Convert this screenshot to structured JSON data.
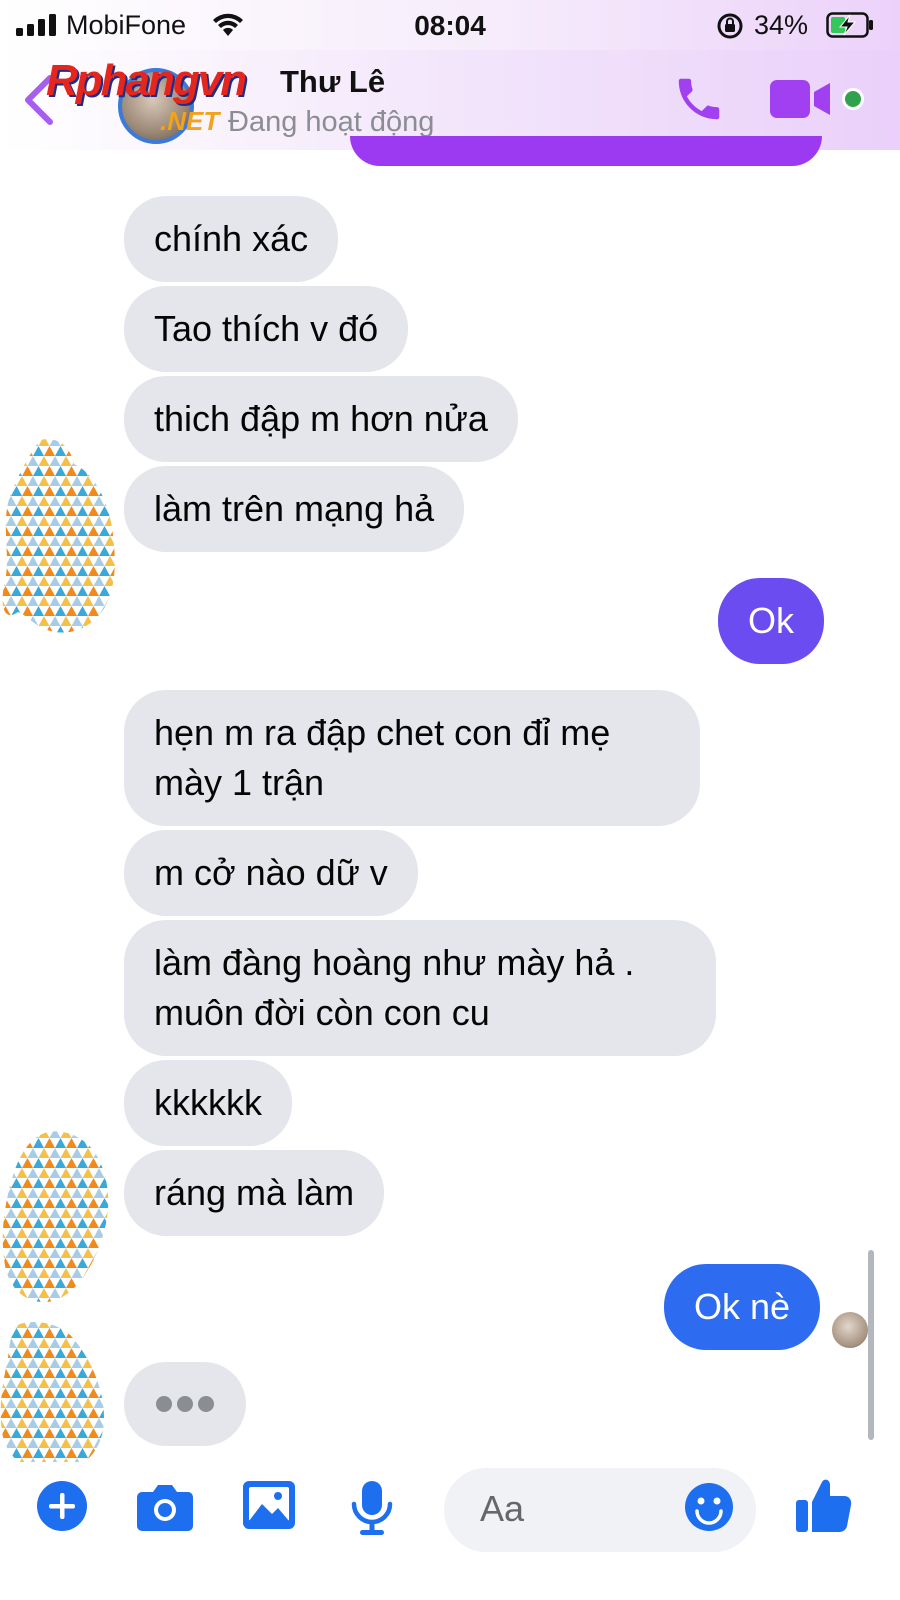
{
  "status_bar": {
    "carrier": "MobiFone",
    "time": "08:04",
    "battery_percent": "34%"
  },
  "header": {
    "watermark": "Rphangvn",
    "watermark_suffix": ".NET",
    "contact_name": "Thư Lê",
    "contact_status": "Đang hoạt động",
    "accent_color": "#9b3af0"
  },
  "messages": [
    {
      "side": "in",
      "text": "chính xác"
    },
    {
      "side": "in",
      "text": "Tao thích v đó"
    },
    {
      "side": "in",
      "text": "thich đập m hơn nửa"
    },
    {
      "side": "in",
      "text": "làm trên mạng hả"
    },
    {
      "side": "out",
      "text": "Ok"
    },
    {
      "side": "in",
      "text": "hẹn m ra đập chet con đỉ mẹ mày 1 trận"
    },
    {
      "side": "in",
      "text": "m cở nào dữ v"
    },
    {
      "side": "in",
      "text": "làm đàng hoàng như mày hả . muôn đời còn con cu"
    },
    {
      "side": "in",
      "text": "kkkkkk"
    },
    {
      "side": "in",
      "text": "ráng mà làm"
    },
    {
      "side": "out",
      "text": "Ok nè"
    }
  ],
  "composer": {
    "placeholder": "Aa",
    "icons": [
      "plus-icon",
      "camera-icon",
      "image-icon",
      "microphone-icon",
      "emoji-icon",
      "thumbs-up-icon"
    ]
  }
}
